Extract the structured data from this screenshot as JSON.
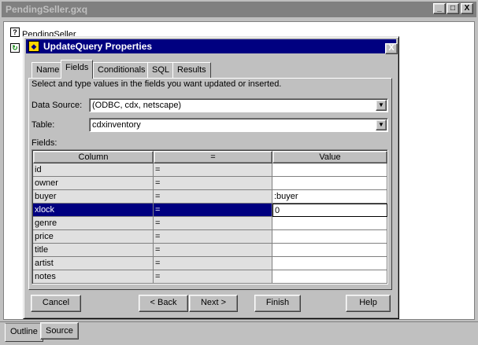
{
  "outer_window": {
    "title": "PendingSeller.gxq",
    "controls": [
      "_",
      "□",
      "X"
    ],
    "tree_label": "PendingSeller",
    "tree_icon_1": "?",
    "tree_icon_2": "↻"
  },
  "bottom_tabs": [
    "Outline",
    "Source"
  ],
  "dialog": {
    "title": "UpdateQuery Properties",
    "close": "X",
    "tabs": [
      "Name",
      "Fields",
      "Conditionals",
      "SQL",
      "Results"
    ],
    "active_tab": "Fields",
    "instructions": "Select and type values in the fields you want updated or inserted.",
    "data_source_label": "Data Source:",
    "data_source_value": "(ODBC, cdx, netscape)",
    "table_label": "Table:",
    "table_value": "cdxinventory",
    "fields_label": "Fields:",
    "grid": {
      "headers": [
        "Column",
        "=",
        "Value"
      ],
      "rows": [
        {
          "column": "id",
          "op": "=",
          "value": ""
        },
        {
          "column": "owner",
          "op": "=",
          "value": ""
        },
        {
          "column": "buyer",
          "op": "=",
          "value": ":buyer"
        },
        {
          "column": "xlock",
          "op": "=",
          "value": "0"
        },
        {
          "column": "genre",
          "op": "=",
          "value": ""
        },
        {
          "column": "price",
          "op": "=",
          "value": ""
        },
        {
          "column": "title",
          "op": "=",
          "value": ""
        },
        {
          "column": "artist",
          "op": "=",
          "value": ""
        },
        {
          "column": "notes",
          "op": "=",
          "value": ""
        }
      ],
      "selected_row": "xlock"
    },
    "buttons": {
      "cancel": "Cancel",
      "back": "< Back",
      "next": "Next >",
      "finish": "Finish",
      "help": "Help"
    }
  },
  "colors": {
    "title_active": "#000080",
    "title_inactive": "#808080",
    "face": "#c0c0c0",
    "selection": "#000080"
  }
}
